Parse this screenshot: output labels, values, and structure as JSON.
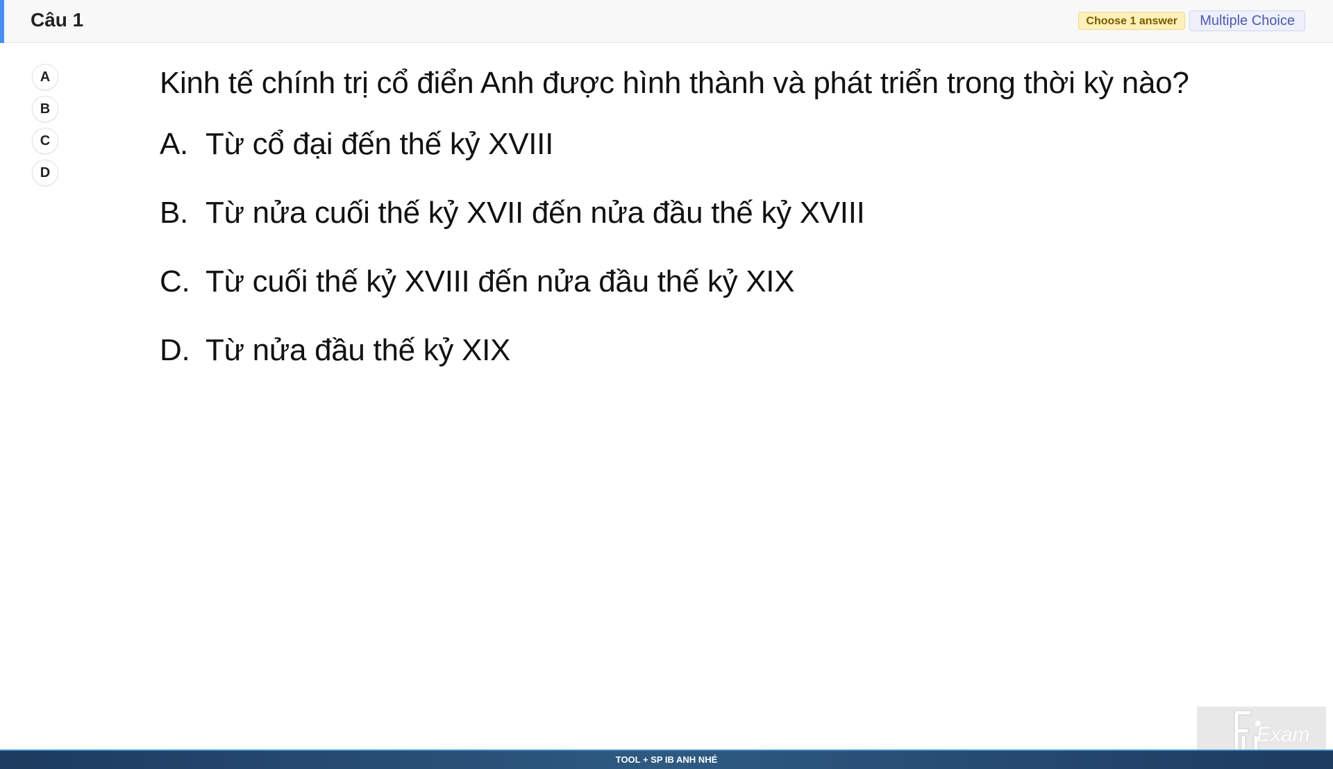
{
  "header": {
    "title": "Câu 1",
    "choose_badge": "Choose 1 answer",
    "type_badge": "Multiple Choice"
  },
  "options": [
    "A",
    "B",
    "C",
    "D"
  ],
  "question": {
    "text": "Kinh tế chính trị cổ điển Anh được hình thành và phát triển trong thời kỳ nào?",
    "answers": [
      {
        "letter": "A.",
        "text": "Từ cổ đại đến thế kỷ XVIII"
      },
      {
        "letter": "B.",
        "text": "Từ nửa cuối thế kỷ XVII đến nửa đầu thế kỷ XVIII"
      },
      {
        "letter": "C.",
        "text": "Từ cuối thế  kỷ XVIII đến nửa đầu thế kỷ XIX"
      },
      {
        "letter": "D.",
        "text": "Từ nửa đầu thế kỷ XIX"
      }
    ]
  },
  "watermark": {
    "logo_text": "Exam"
  },
  "footer": {
    "text": "TOOL + SP IB ANH NHÉ"
  },
  "colors": {
    "accent": "#4a8ef0",
    "badge_choose_bg": "#fdf0b8",
    "badge_type_bg": "#eef0fb",
    "footer_bg": "#1d3a5f"
  }
}
